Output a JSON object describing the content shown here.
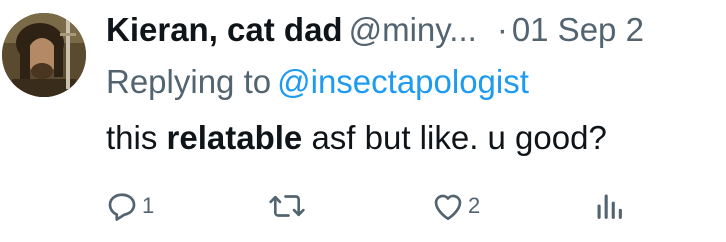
{
  "author": {
    "name": "Kieran, cat dad",
    "handle": "@miny...",
    "separator": "·",
    "date": "01 Sep 2"
  },
  "reply": {
    "prefix": "Replying to",
    "mention": "@insectapologist"
  },
  "body": {
    "before": "this ",
    "bold": "relatable",
    "after": " asf but like. u good?"
  },
  "actions": {
    "reply_count": "1",
    "retweet_count": "",
    "like_count": "2"
  },
  "colors": {
    "text": "#0f1419",
    "muted": "#536471",
    "link": "#1d9bf0"
  },
  "icons": [
    "avatar",
    "reply-icon",
    "retweet-icon",
    "like-icon",
    "views-icon"
  ]
}
